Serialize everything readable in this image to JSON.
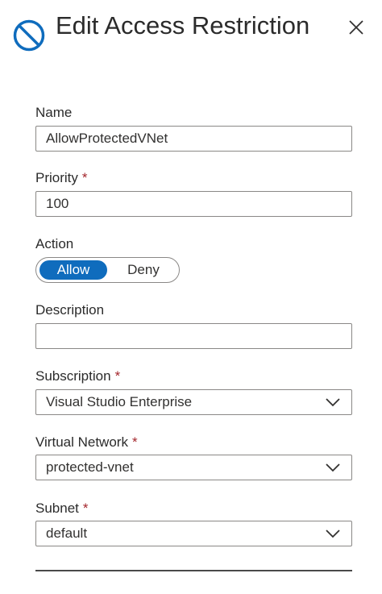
{
  "header": {
    "title": "Edit Access Restriction",
    "icon": "block-icon",
    "close_icon": "close-icon"
  },
  "form": {
    "name": {
      "label": "Name",
      "value": "AllowProtectedVNet"
    },
    "priority": {
      "label": "Priority",
      "required_mark": "*",
      "value": "100"
    },
    "action": {
      "label": "Action",
      "options": [
        "Allow",
        "Deny"
      ],
      "selected": "Allow"
    },
    "description": {
      "label": "Description",
      "value": ""
    },
    "subscription": {
      "label": "Subscription",
      "required_mark": "*",
      "value": "Visual Studio Enterprise"
    },
    "virtual_network": {
      "label": "Virtual Network",
      "required_mark": "*",
      "value": "protected-vnet"
    },
    "subnet": {
      "label": "Subnet",
      "required_mark": "*",
      "value": "default"
    }
  },
  "colors": {
    "accent": "#0f6cbd",
    "required": "#a4262c",
    "border": "#8a8886"
  }
}
